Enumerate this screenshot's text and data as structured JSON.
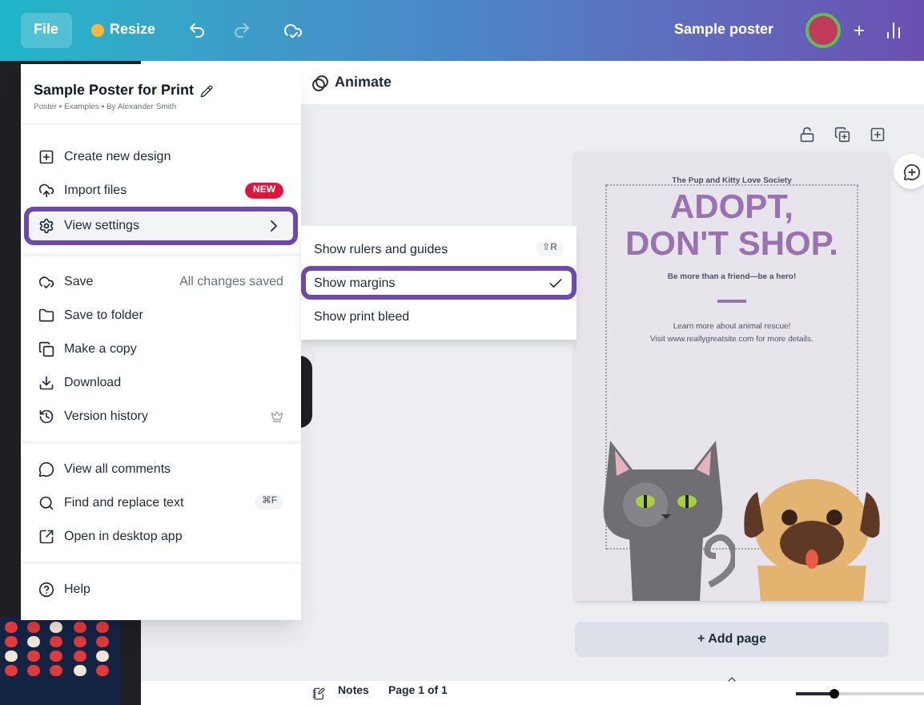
{
  "header": {
    "file": "File",
    "resize": "Resize",
    "doc_name": "Sample poster",
    "plus": "+"
  },
  "toolbar": {
    "animate": "Animate"
  },
  "menu": {
    "title": "Sample Poster for Print",
    "subtitle": "Poster • Examples • By Alexander Smith",
    "groups": [
      [
        {
          "label": "Create new design",
          "kind": "plain",
          "selected": false
        },
        {
          "label": "Import files",
          "kind": "badge",
          "badge": "NEW",
          "selected": false
        },
        {
          "label": "View settings",
          "kind": "submenu",
          "selected": true
        }
      ],
      [
        {
          "label": "Save",
          "kind": "status",
          "status": "All changes saved",
          "selected": false
        },
        {
          "label": "Save to folder",
          "kind": "plain",
          "selected": false
        },
        {
          "label": "Make a copy",
          "kind": "plain",
          "selected": false
        },
        {
          "label": "Download",
          "kind": "plain",
          "selected": false
        },
        {
          "label": "Version history",
          "kind": "premium",
          "selected": false
        }
      ],
      [
        {
          "label": "View all comments",
          "kind": "plain",
          "selected": false
        },
        {
          "label": "Find and replace text",
          "kind": "shortcut",
          "shortcut": "⌘F",
          "selected": false
        },
        {
          "label": "Open in desktop app",
          "kind": "plain",
          "selected": false
        }
      ],
      [
        {
          "label": "Help",
          "kind": "plain",
          "selected": false
        }
      ]
    ]
  },
  "submenu": [
    {
      "label": "Show rulers and guides",
      "shortcut": "⇧R",
      "checked": false,
      "selected": false
    },
    {
      "label": "Show margins",
      "checked": true,
      "selected": true
    },
    {
      "label": "Show print bleed",
      "checked": false,
      "selected": false
    }
  ],
  "poster": {
    "org": "The Pup and Kitty Love Society",
    "headline": [
      "ADOPT,",
      "DON'T SHOP."
    ],
    "tagline": "Be more than a friend—be a hero!",
    "info": [
      "Learn more about animal rescue!",
      "Visit www.reallygreatsite.com for more details."
    ]
  },
  "add_page": "+ Add page",
  "footer": {
    "notes": "Notes",
    "page": "Page 1 of 1",
    "zoom": {
      "level": 0.3
    }
  }
}
